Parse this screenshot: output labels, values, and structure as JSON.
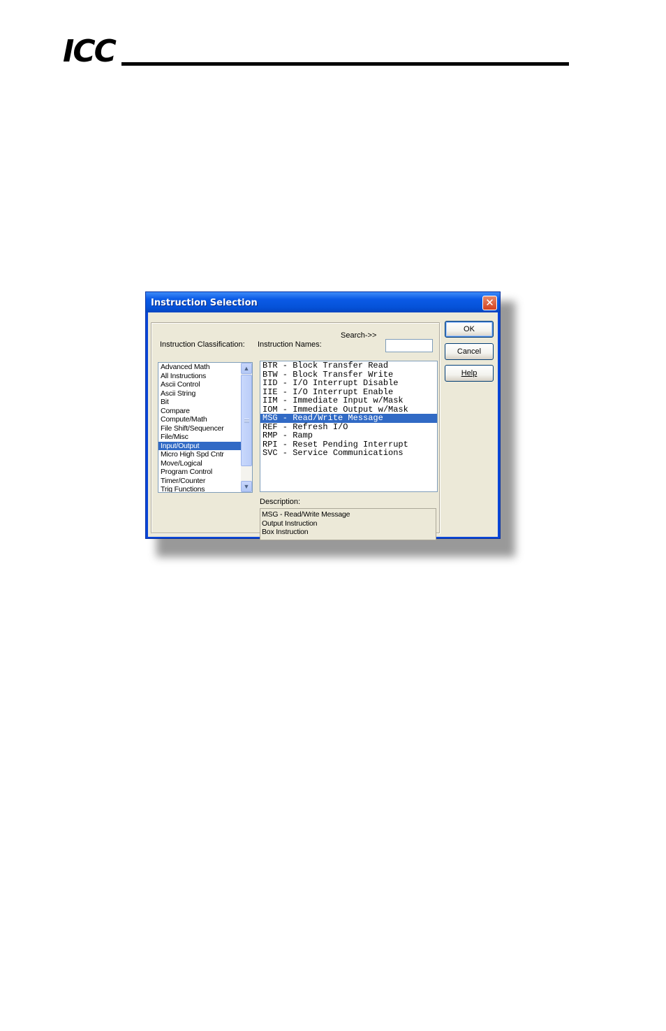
{
  "header": {
    "logo_text": "ICC"
  },
  "dialog": {
    "title": "Instruction Selection",
    "close_glyph": "✕",
    "classification_label": "Instruction Classification:",
    "names_label": "Instruction Names:",
    "search_label": "Search->>",
    "search_value": "",
    "description_label": "Description:",
    "classifications": [
      "Advanced Math",
      "All Instructions",
      "Ascii Control",
      "Ascii String",
      "Bit",
      "Compare",
      "Compute/Math",
      "File Shift/Sequencer",
      "File/Misc",
      "Input/Output",
      "Micro High Spd Cntr",
      "Move/Logical",
      "Program Control",
      "Timer/Counter",
      "Trig Functions"
    ],
    "selected_classification": "Input/Output",
    "instruction_names": [
      "BTR - Block Transfer Read",
      "BTW - Block Transfer Write",
      "IID - I/O Interrupt Disable",
      "IIE - I/O Interrupt Enable",
      "IIM - Immediate Input w/Mask",
      "IOM - Immediate Output w/Mask",
      "MSG - Read/Write Message",
      "REF - Refresh I/O",
      "RMP - Ramp",
      "RPI - Reset Pending Interrupt",
      "SVC - Service Communications"
    ],
    "selected_instruction": "MSG - Read/Write Message",
    "description_lines": [
      "MSG - Read/Write Message",
      "Output Instruction",
      "Box Instruction"
    ],
    "buttons": {
      "ok": "OK",
      "cancel": "Cancel",
      "help": "Help"
    },
    "scroll_up_glyph": "▲",
    "scroll_down_glyph": "▼"
  }
}
